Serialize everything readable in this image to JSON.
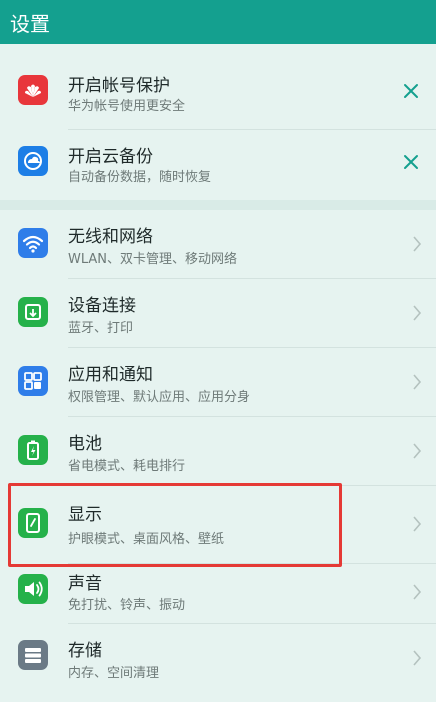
{
  "header": {
    "title": "设置"
  },
  "items": [
    {
      "label": "开启帐号保护",
      "sub": "华为帐号使用更安全",
      "icon": "huawei-logo-icon",
      "color": "#e8363b",
      "action": "close"
    },
    {
      "label": "开启云备份",
      "sub": "自动备份数据，随时恢复",
      "icon": "cloud-backup-icon",
      "color": "#1d7ee6",
      "action": "close"
    },
    {
      "label": "无线和网络",
      "sub": "WLAN、双卡管理、移动网络",
      "icon": "wifi-icon",
      "color": "#2f7de9",
      "action": "chevron"
    },
    {
      "label": "设备连接",
      "sub": "蓝牙、打印",
      "icon": "device-connect-icon",
      "color": "#25b14a",
      "action": "chevron"
    },
    {
      "label": "应用和通知",
      "sub": "权限管理、默认应用、应用分身",
      "icon": "apps-grid-icon",
      "color": "#2f7de9",
      "action": "chevron"
    },
    {
      "label": "电池",
      "sub": "省电模式、耗电排行",
      "icon": "battery-icon",
      "color": "#25b14a",
      "action": "chevron"
    },
    {
      "label": "显示",
      "sub": "护眼模式、桌面风格、壁纸",
      "icon": "display-icon",
      "color": "#25b14a",
      "action": "chevron"
    },
    {
      "label": "声音",
      "sub": "免打扰、铃声、振动",
      "icon": "speaker-icon",
      "color": "#25b14a",
      "action": "chevron"
    },
    {
      "label": "存储",
      "sub": "内存、空间清理",
      "icon": "storage-icon",
      "color": "#6b7a86",
      "action": "chevron"
    }
  ],
  "highlight_color": "#e53935"
}
